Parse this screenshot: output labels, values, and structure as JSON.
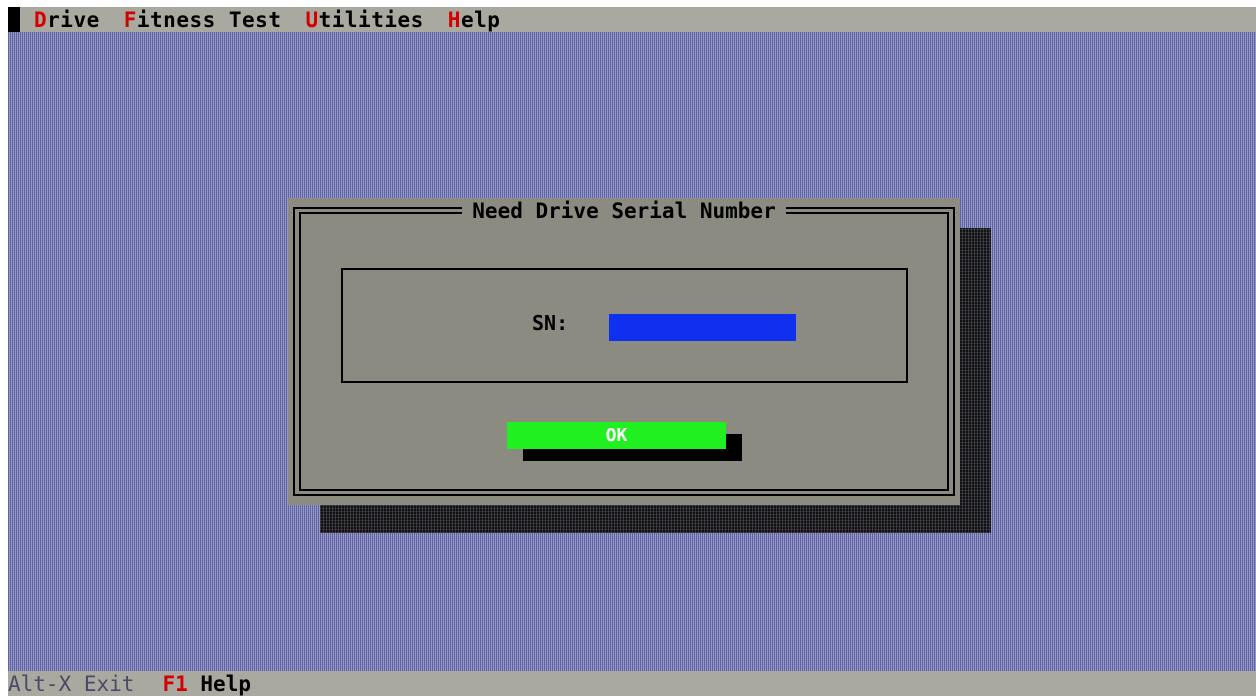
{
  "menu": {
    "items": [
      {
        "hotkey": "D",
        "rest": "rive"
      },
      {
        "hotkey": "F",
        "rest": "itness Test"
      },
      {
        "hotkey": "U",
        "rest": "tilities"
      },
      {
        "hotkey": "H",
        "rest": "elp"
      }
    ]
  },
  "dialog": {
    "title": "Need Drive Serial Number",
    "sn_label": "SN:",
    "sn_value": "",
    "ok_label": "OK"
  },
  "status": {
    "exit_key": "Alt-X",
    "exit_label": "Exit",
    "help_key": "F1",
    "help_label": "Help"
  },
  "colors": {
    "menu_bg": "#a9a9a0",
    "hotkey": "#d40000",
    "desktop": "#8a8fc0",
    "dialog_bg": "#8b8b82",
    "input_bg": "#1030f0",
    "ok_bg": "#20f020"
  }
}
